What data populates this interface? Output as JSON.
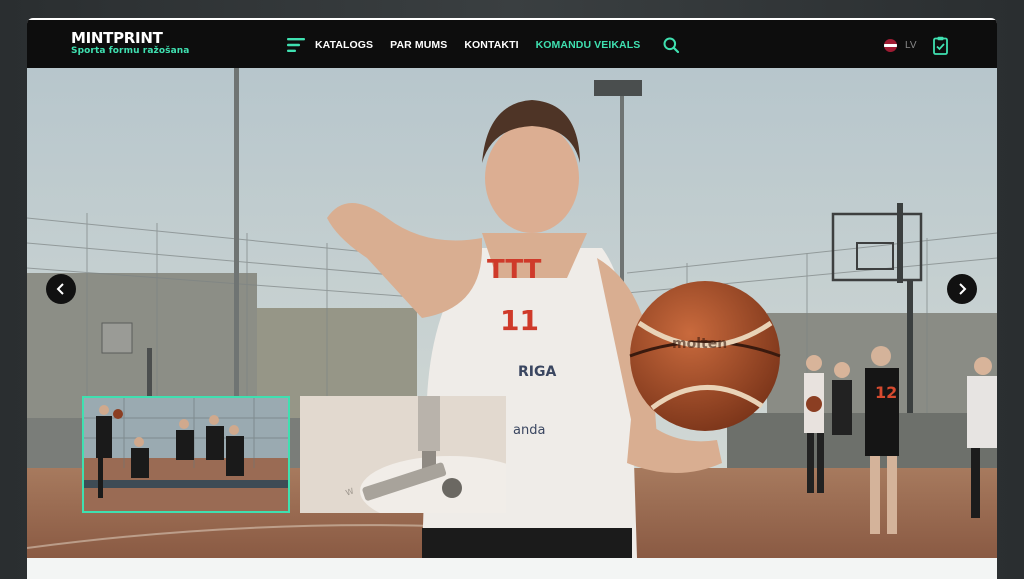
{
  "brand": {
    "name": "MINTPRINT",
    "tagline": "Sporta formu ražošana"
  },
  "nav": {
    "menu_icon": "hamburger-menu-icon",
    "items": [
      {
        "label": "KATALOGS"
      },
      {
        "label": "PAR MUMS"
      },
      {
        "label": "KONTAKTI"
      },
      {
        "label": "KOMANDU VEIKALS"
      }
    ],
    "search_icon": "search-icon"
  },
  "lang": {
    "code": "LV",
    "flag_icon": "latvia-flag-icon"
  },
  "cart_icon": "clipboard-icon",
  "colors": {
    "accent": "#3fe0b0",
    "header_bg": "#0d0d0d"
  },
  "slider": {
    "prev_icon": "chevron-left-icon",
    "next_icon": "chevron-right-icon",
    "jersey_text": {
      "top": "TTT",
      "number": "11",
      "sponsor": "RIGA",
      "sponsor2": "anda"
    },
    "ball_text": "molten"
  }
}
